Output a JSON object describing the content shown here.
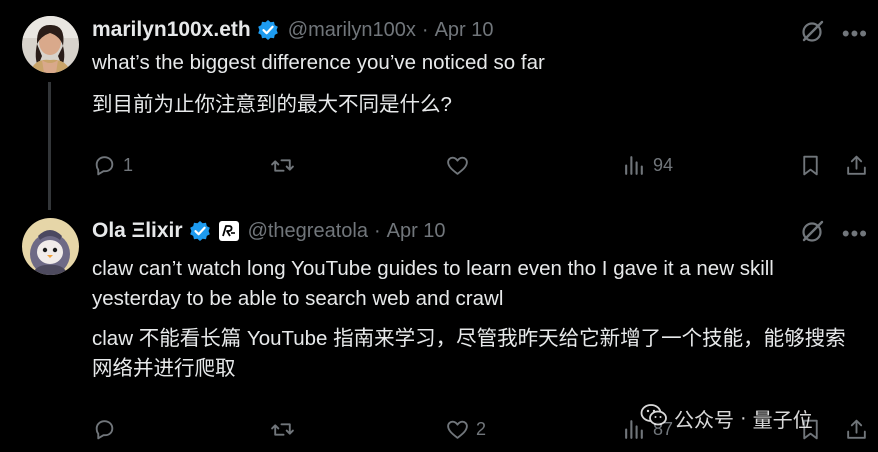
{
  "tweets": [
    {
      "name": "marilyn100x.eth",
      "handle": "@marilyn100x",
      "date": "Apr 10",
      "text_en": "what’s the biggest difference you’ve noticed so far",
      "text_zh": "到目前为止你注意到的最大不同是什么?",
      "replies": "1",
      "reposts": "",
      "likes": "",
      "views": "94"
    },
    {
      "name": "Ola Ξlixir",
      "handle": "@thegreatola",
      "date": "Apr 10",
      "text_en": "claw can’t watch long YouTube guides to learn even tho I gave it a new skill yesterday to be able to search web and crawl",
      "text_zh": "claw 不能看长篇 YouTube 指南来学习，尽管我昨天给它新增了一个技能，能够搜索网络并进行爬取",
      "replies": "",
      "reposts": "",
      "likes": "2",
      "views": "87"
    }
  ],
  "separator": "·",
  "watermark": {
    "left": "公众号",
    "dot": "·",
    "right": "量子位"
  },
  "colors": {
    "background": "#000000",
    "text": "#e7e9ea",
    "muted": "#71767b",
    "verified": "#1d9bf0"
  }
}
